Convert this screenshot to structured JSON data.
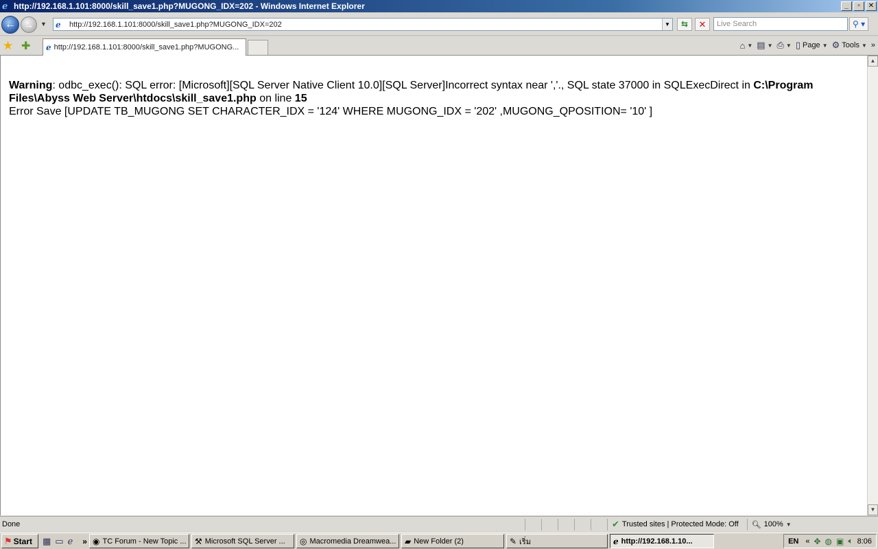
{
  "window": {
    "title": "http://192.168.1.101:8000/skill_save1.php?MUGONG_IDX=202 - Windows Internet Explorer"
  },
  "address": {
    "url": "http://192.168.1.101:8000/skill_save1.php?MUGONG_IDX=202",
    "search_placeholder": "Live Search"
  },
  "tabs": [
    {
      "label": "http://192.168.1.101:8000/skill_save1.php?MUGONG..."
    }
  ],
  "command_bar": {
    "page_label": "Page",
    "tools_label": "Tools"
  },
  "content": {
    "warning_label": "Warning",
    "warning_text": ": odbc_exec(): SQL error: [Microsoft][SQL Server Native Client 10.0][SQL Server]Incorrect syntax near ','., SQL state 37000 in SQLExecDirect in ",
    "file_path": "C:\\Program Files\\Abyss Web Server\\htdocs\\skill_save1.php",
    "on_line_text": " on line ",
    "line_number": "15",
    "error_line": "Error Save [UPDATE TB_MUGONG SET CHARACTER_IDX = '124' WHERE MUGONG_IDX = '202' ,MUGONG_QPOSITION= '10' ]"
  },
  "status": {
    "text": "Done",
    "zone": "Trusted sites | Protected Mode: Off",
    "zoom": "100%"
  },
  "taskbar": {
    "start_label": "Start",
    "items": [
      {
        "label": "TC Forum - New Topic ..."
      },
      {
        "label": "Microsoft SQL Server ..."
      },
      {
        "label": "Macromedia Dreamwea..."
      },
      {
        "label": "New Folder (2)"
      },
      {
        "label": "เริ่ม"
      },
      {
        "label": "http://192.168.1.10..."
      }
    ],
    "language": "EN",
    "clock": "8:06"
  },
  "colors": {
    "titlebar_start": "#0a246a",
    "titlebar_end": "#a6caf0",
    "page_background": "#ffffff",
    "chrome_background": "#dcdad5"
  },
  "icons": [
    "ie-icon",
    "back-arrow-icon",
    "forward-arrow-icon",
    "refresh-icon",
    "stop-icon",
    "search-icon",
    "favorites-star-icon",
    "add-favorites-icon",
    "home-icon",
    "feeds-icon",
    "print-icon",
    "page-icon",
    "tools-gear-icon",
    "trusted-check-icon",
    "zoom-icon"
  ]
}
